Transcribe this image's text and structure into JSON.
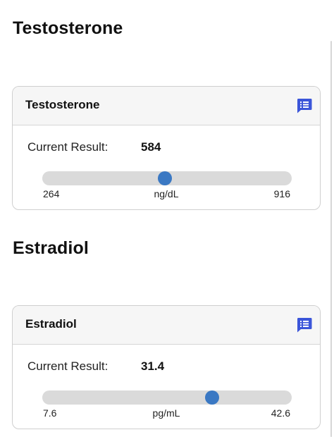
{
  "sections": [
    {
      "heading": "Testosterone",
      "card_title": "Testosterone",
      "result_label": "Current Result:",
      "result_value": "584",
      "value": 584,
      "min_label": "264",
      "max_label": "916",
      "min": 264,
      "max": 916,
      "unit": "ng/dL",
      "notes_icon": "notes-icon"
    },
    {
      "heading": "Estradiol",
      "card_title": "Estradiol",
      "result_label": "Current Result:",
      "result_value": "31.4",
      "value": 31.4,
      "min_label": "7.6",
      "max_label": "42.6",
      "min": 7.6,
      "max": 42.6,
      "unit": "pg/mL",
      "notes_icon": "notes-icon"
    }
  ],
  "colors": {
    "accent": "#3a78c3",
    "notes_icon": "#3b55d9",
    "track": "#dadada",
    "header_bg": "#f6f6f6"
  }
}
